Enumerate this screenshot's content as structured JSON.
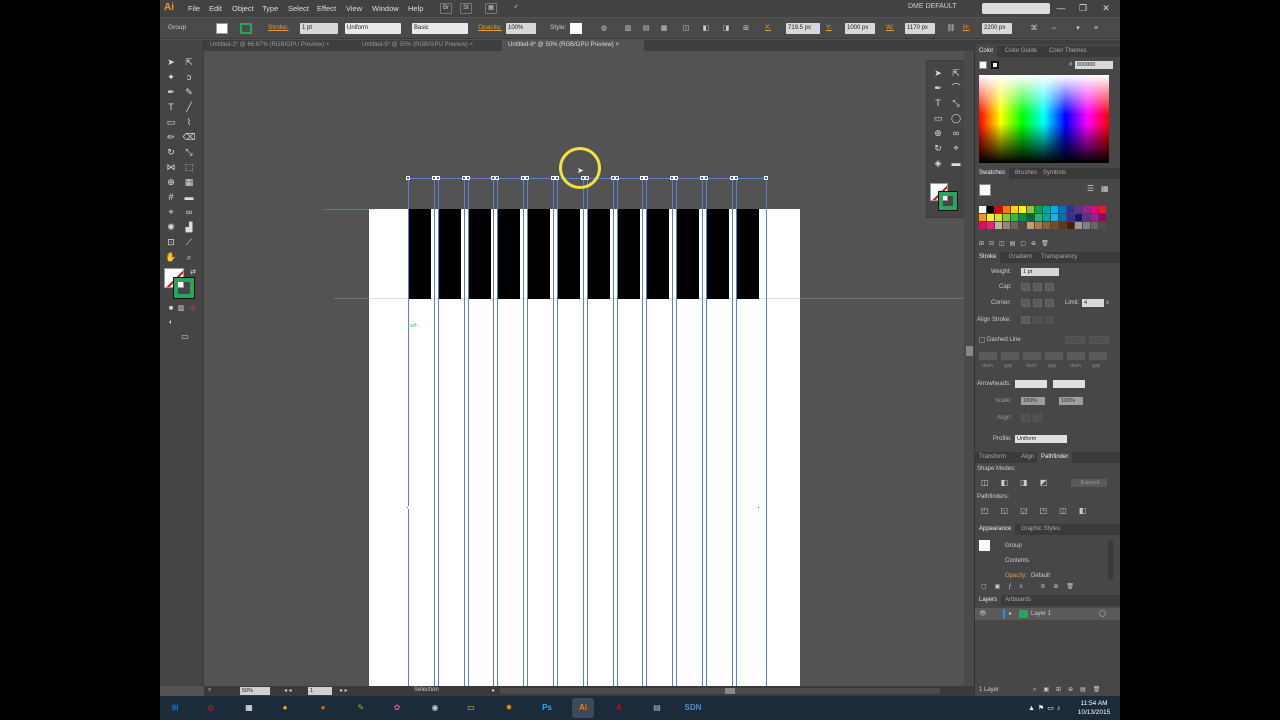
{
  "app": {
    "logo": "Ai",
    "menu": [
      "File",
      "Edit",
      "Object",
      "Type",
      "Select",
      "Effect",
      "View",
      "Window",
      "Help"
    ],
    "workspace": "DME DEFAULT",
    "window_controls": [
      "—",
      "❐",
      "✕"
    ]
  },
  "control_bar": {
    "selection_type": "Group",
    "stroke_label": "Stroke:",
    "stroke_weight": "1 pt",
    "profile": "Uniform",
    "brush": "Basic",
    "opacity_label": "Opacity:",
    "opacity_value": "100%",
    "style_label": "Style:",
    "x_label": "X:",
    "x_value": "719.5 px",
    "y_label": "Y:",
    "y_value": "1000 px",
    "w_label": "W:",
    "w_value": "1170 px",
    "h_label": "H:",
    "h_value": "2200 px"
  },
  "tabs": [
    {
      "label": "Untitled-2* @ 66.67% (RGB/GPU Preview)",
      "active": false
    },
    {
      "label": "Untitled-5* @ 50% (RGB/GPU Preview)",
      "active": false
    },
    {
      "label": "Untitled-6* @ 50% (RGB/GPU Preview)",
      "active": true
    }
  ],
  "tab_close": "×",
  "canvas": {
    "path_label": "path"
  },
  "status_bar": {
    "zoom": "50%",
    "artboard": "1",
    "tool": "Selection"
  },
  "color_panel": {
    "tabs": [
      "Color",
      "Color Guide",
      "Color Themes"
    ],
    "hex": "000000"
  },
  "swatches_panel": {
    "tabs": [
      "Swatches",
      "Brushes",
      "Symbols"
    ],
    "colors": [
      "#ffffff",
      "#000000",
      "#e00000",
      "#ff7a00",
      "#ffd400",
      "#fff200",
      "#8cc63e",
      "#00a651",
      "#00a99d",
      "#00aeef",
      "#0072bc",
      "#2e3192",
      "#662d91",
      "#92278f",
      "#ec008c",
      "#ed1c24",
      "#f7941d",
      "#fcee21",
      "#d9e021",
      "#8dc63f",
      "#39b54a",
      "#009245",
      "#006837",
      "#22b573",
      "#00a99d",
      "#29abe2",
      "#0071bc",
      "#2e3192",
      "#1b1464",
      "#662d91",
      "#93278f",
      "#9e005d",
      "#d4145a",
      "#ed1e79",
      "#c7b299",
      "#998675",
      "#736357",
      "#534741",
      "#c69c6d",
      "#a67c52",
      "#8c6239",
      "#754c24",
      "#603813",
      "#42210b",
      "#999999",
      "#808080",
      "#666666",
      "#4d4d4d"
    ]
  },
  "stroke_panel": {
    "tabs": [
      "Stroke",
      "Gradient",
      "Transparency"
    ],
    "weight_label": "Weight:",
    "weight_value": "1 pt",
    "cap_label": "Cap:",
    "corner_label": "Corner:",
    "limit_label": "Limit:",
    "limit_value": "4",
    "limit_unit": "x",
    "align_label": "Align Stroke:",
    "dashed_label": "Dashed Line",
    "dash_labels": [
      "dash",
      "gap",
      "dash",
      "gap",
      "dash",
      "gap"
    ],
    "arrowheads_label": "Arrowheads:",
    "scale_label": "Scale:",
    "scale_values": [
      "100%",
      "100%"
    ],
    "align_arrow_label": "Align:",
    "profile_label": "Profile:",
    "profile_value": "Uniform"
  },
  "pathfinder_panel": {
    "tabs": [
      "Transform",
      "Align",
      "Pathfinder"
    ],
    "shape_modes": "Shape Modes:",
    "pathfinders": "Pathfinders:",
    "expand": "Expand"
  },
  "appearance_panel": {
    "tabs": [
      "Appearance",
      "Graphic Styles"
    ],
    "group": "Group",
    "contents": "Contents",
    "opacity_label": "Opacity:",
    "opacity_value": "Default"
  },
  "layers_panel": {
    "tabs": [
      "Layers",
      "Artboards"
    ],
    "layer_name": "Layer 1",
    "count": "1 Layer"
  },
  "taskbar": {
    "icons": [
      {
        "name": "start-icon",
        "glyph": "⊞",
        "color": "#1e7bd6"
      },
      {
        "name": "cc-icon",
        "glyph": "◎",
        "color": "#d41f26"
      },
      {
        "name": "apps-icon",
        "glyph": "▦",
        "color": "#ffffff"
      },
      {
        "name": "chrome-icon",
        "glyph": "●",
        "color": "#e8b520"
      },
      {
        "name": "firefox-icon",
        "glyph": "●",
        "color": "#e66000"
      },
      {
        "name": "notepadpp-icon",
        "glyph": "✎",
        "color": "#7fbf3f"
      },
      {
        "name": "picasa-icon",
        "glyph": "✿",
        "color": "#d94fa0"
      },
      {
        "name": "app-icon",
        "glyph": "◉",
        "color": "#cccccc"
      },
      {
        "name": "explorer-icon",
        "glyph": "▭",
        "color": "#e8c26a"
      },
      {
        "name": "burn-icon",
        "glyph": "✹",
        "color": "#f08a00"
      },
      {
        "name": "photoshop-icon",
        "glyph": "Ps",
        "color": "#31a8ff"
      },
      {
        "name": "illustrator-icon",
        "glyph": "Ai",
        "color": "#ff7c00"
      },
      {
        "name": "acrobat-icon",
        "glyph": "A",
        "color": "#d0021b"
      },
      {
        "name": "notes-icon",
        "glyph": "▤",
        "color": "#9fb9d9"
      },
      {
        "name": "sdn-icon",
        "glyph": "SDN",
        "color": "#4a8fd1"
      }
    ],
    "time": "11:54 AM",
    "date": "10/13/2015"
  }
}
